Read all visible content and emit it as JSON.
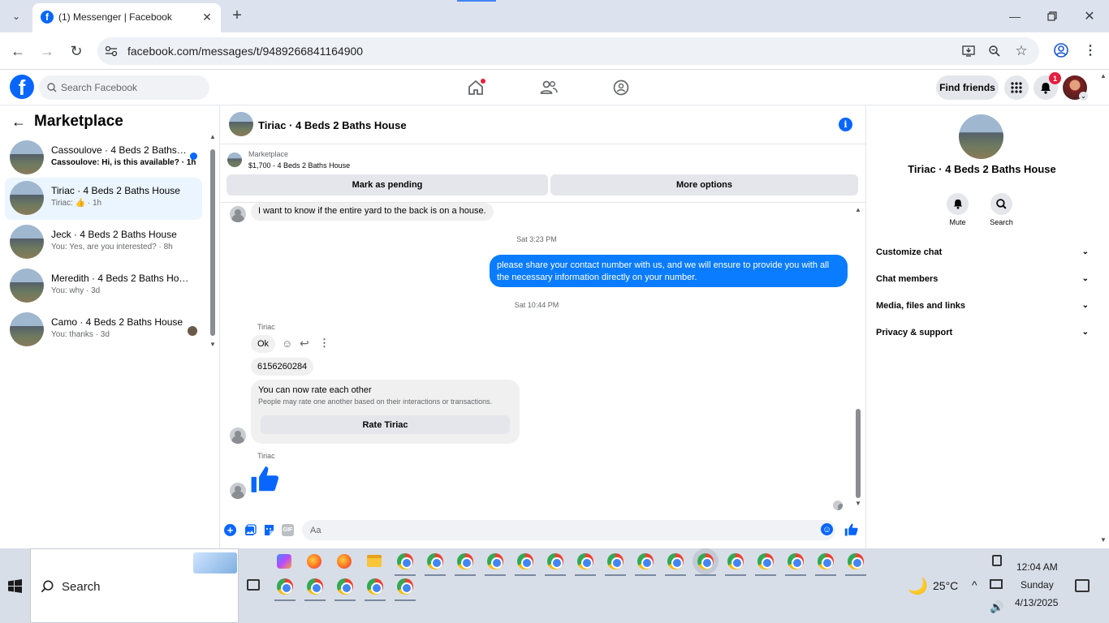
{
  "browser": {
    "tab_title": "(1) Messenger | Facebook",
    "url": "facebook.com/messages/t/9489266841164900"
  },
  "fb_header": {
    "search_placeholder": "Search Facebook",
    "find_friends": "Find friends",
    "notification_count": "1"
  },
  "left_panel": {
    "title": "Marketplace",
    "conversations": [
      {
        "name": "Cassoulove · 4 Beds 2 Baths H...",
        "preview": "Cassoulove: Hi, is this available? · 1h",
        "unread": true,
        "selected": false
      },
      {
        "name": "Tiriac · 4 Beds 2 Baths House",
        "preview_prefix": "Tiriac:",
        "preview_suffix": "· 1h",
        "selected": true
      },
      {
        "name": "Jeck · 4 Beds 2 Baths House",
        "preview": "You: Yes, are you interested? · 8h"
      },
      {
        "name": "Meredith · 4 Beds 2 Baths House",
        "preview": "You: why · 3d"
      },
      {
        "name": "Camo · 4 Beds 2 Baths House",
        "preview": "You: thanks · 3d"
      }
    ]
  },
  "chat": {
    "title": "Tiriac · 4 Beds 2 Baths House",
    "listing_label": "Marketplace",
    "listing_detail": "$1,700 - 4 Beds 2 Baths House",
    "mark_pending": "Mark as pending",
    "more_options": "More options",
    "messages": {
      "incoming_1": "I want to know if the entire yard to the back is on a house.",
      "time_1": "Sat 3:23 PM",
      "outgoing_1": "please share your contact number with us, and we will ensure to provide you with all the necessary information directly on your number.",
      "time_2": "Sat 10:44 PM",
      "sender_1": "Tiriac",
      "incoming_2": "Ok",
      "incoming_3": "6156260284",
      "rate_title": "You can now rate each other",
      "rate_sub": "People may rate one another based on their interactions or transactions.",
      "rate_button": "Rate Tiriac",
      "sender_2": "Tiriac"
    },
    "composer_placeholder": "Aa"
  },
  "right_panel": {
    "title": "Tiriac · 4 Beds 2 Baths House",
    "mute": "Mute",
    "search": "Search",
    "sections": [
      "Customize chat",
      "Chat members",
      "Media, files and links",
      "Privacy & support"
    ]
  },
  "taskbar": {
    "search": "Search",
    "weather": "25°C",
    "time": "12:04 AM",
    "day": "Sunday",
    "date": "4/13/2025"
  },
  "colors": {
    "fb_blue": "#0866ff",
    "bubble_blue": "#0a7cff",
    "badge_red": "#e41e3f"
  }
}
